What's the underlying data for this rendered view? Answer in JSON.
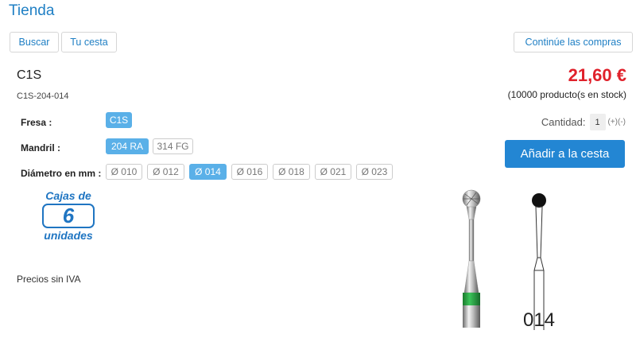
{
  "header": {
    "title": "Tienda"
  },
  "nav": {
    "search_label": "Buscar",
    "cart_label": "Tu cesta",
    "continue_label": "Continúe las compras"
  },
  "product": {
    "name": "C1S",
    "reference": "C1S-204-014",
    "price": "21,60 €",
    "stock": "(10000 producto(s en stock)",
    "vat_note": "Precios sin IVA"
  },
  "quantity": {
    "label": "Cantidad:",
    "value": "1",
    "controls": "(+)(-)"
  },
  "add_to_cart_label": "Añadir a la cesta",
  "options": {
    "bur": {
      "label": "Fresa :",
      "values": [
        "C1S"
      ],
      "selected": "C1S"
    },
    "shank": {
      "label": "Mandril :",
      "values": [
        "204 RA",
        "314 FG"
      ],
      "selected": "204 RA"
    },
    "diameter": {
      "label": "Diámetro en mm :",
      "values": [
        "Ø 010",
        "Ø 012",
        "Ø 014",
        "Ø 016",
        "Ø 018",
        "Ø 021",
        "Ø 023"
      ],
      "selected": "Ø 014"
    }
  },
  "pack": {
    "top": "Cajas de",
    "count": "6",
    "bottom": "unidades"
  },
  "diagram": {
    "label": "014"
  },
  "colors": {
    "accent": "#1f7fc4",
    "price": "#e0212b",
    "selected_chip": "#5ab0e8",
    "band": "#2ea043"
  }
}
